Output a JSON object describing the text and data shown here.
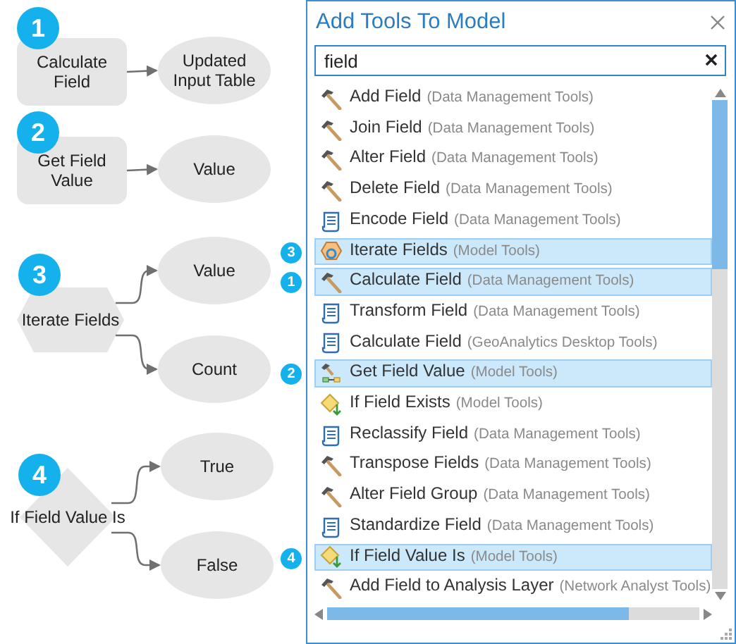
{
  "diagram": {
    "nodes": [
      {
        "kind": "process",
        "badge": "1",
        "label": [
          "Calculate",
          "Field"
        ],
        "outputs": [
          [
            "Updated",
            "Input Table"
          ]
        ]
      },
      {
        "kind": "process",
        "badge": "2",
        "label": [
          "Get Field",
          "Value"
        ],
        "outputs": [
          [
            "Value"
          ]
        ]
      },
      {
        "kind": "iterator",
        "badge": "3",
        "label": [
          "Iterate Fields"
        ],
        "outputs": [
          [
            "Value"
          ],
          [
            "Count"
          ]
        ]
      },
      {
        "kind": "condition",
        "badge": "4",
        "label": [
          "If Field Value Is"
        ],
        "outputs": [
          [
            "True"
          ],
          [
            "False"
          ]
        ]
      }
    ]
  },
  "panel": {
    "title": "Add Tools To Model",
    "search": {
      "value": "field"
    },
    "tools": [
      {
        "name": "Add Field",
        "toolbox": "(Data Management Tools)",
        "kind": "hammer",
        "selected": false
      },
      {
        "name": "Join Field",
        "toolbox": "(Data Management Tools)",
        "kind": "hammer",
        "selected": false
      },
      {
        "name": "Alter Field",
        "toolbox": "(Data Management Tools)",
        "kind": "hammer",
        "selected": false
      },
      {
        "name": "Delete Field",
        "toolbox": "(Data Management Tools)",
        "kind": "hammer",
        "selected": false
      },
      {
        "name": "Encode Field",
        "toolbox": "(Data Management Tools)",
        "kind": "script",
        "selected": false
      },
      {
        "name": "Iterate Fields",
        "toolbox": "(Model Tools)",
        "kind": "iterator",
        "selected": true,
        "badge": "3"
      },
      {
        "name": "Calculate Field",
        "toolbox": "(Data Management Tools)",
        "kind": "hammer",
        "selected": true,
        "badge": "1"
      },
      {
        "name": "Transform Field",
        "toolbox": "(Data Management Tools)",
        "kind": "script",
        "selected": false
      },
      {
        "name": "Calculate Field",
        "toolbox": "(GeoAnalytics Desktop Tools)",
        "kind": "script",
        "selected": false
      },
      {
        "name": "Get Field Value",
        "toolbox": "(Model Tools)",
        "kind": "model",
        "selected": true,
        "badge": "2"
      },
      {
        "name": "If Field Exists",
        "toolbox": "(Model Tools)",
        "kind": "condition",
        "selected": false
      },
      {
        "name": "Reclassify Field",
        "toolbox": "(Data Management Tools)",
        "kind": "script",
        "selected": false
      },
      {
        "name": "Transpose Fields",
        "toolbox": "(Data Management Tools)",
        "kind": "hammer",
        "selected": false
      },
      {
        "name": "Alter Field Group",
        "toolbox": "(Data Management Tools)",
        "kind": "hammer",
        "selected": false
      },
      {
        "name": "Standardize Field",
        "toolbox": "(Data Management Tools)",
        "kind": "script",
        "selected": false
      },
      {
        "name": "If Field Value Is",
        "toolbox": "(Model Tools)",
        "kind": "condition",
        "selected": true,
        "badge": "4"
      },
      {
        "name": "Add Field to Analysis Layer",
        "toolbox": "(Network Analyst Tools)",
        "kind": "hammer",
        "selected": false
      }
    ]
  }
}
